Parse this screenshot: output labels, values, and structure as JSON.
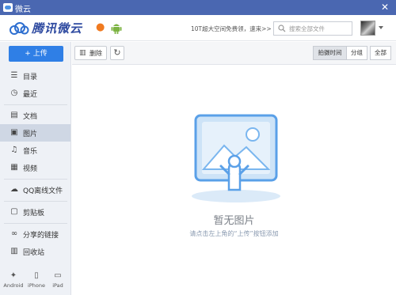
{
  "window": {
    "title": "微云",
    "close_glyph": "✕"
  },
  "header": {
    "logo_text": "腾讯微云",
    "promo": "10T超大空间免费领，速来>>",
    "search_placeholder": "搜索全部文件"
  },
  "sidebar": {
    "upload_label": "+ 上传",
    "items": [
      {
        "label": "目录",
        "icon": "catalog-icon"
      },
      {
        "label": "最近",
        "icon": "clock-icon"
      },
      {
        "label": "文档",
        "icon": "document-icon"
      },
      {
        "label": "图片",
        "icon": "image-icon",
        "active": true
      },
      {
        "label": "音乐",
        "icon": "music-icon"
      },
      {
        "label": "视频",
        "icon": "video-icon"
      },
      {
        "label": "QQ离线文件",
        "icon": "qq-icon"
      },
      {
        "label": "剪贴板",
        "icon": "clipboard-icon"
      },
      {
        "label": "分享的链接",
        "icon": "link-icon"
      },
      {
        "label": "回收站",
        "icon": "trash-icon"
      }
    ],
    "devices": [
      {
        "label": "Android",
        "icon": "android-icon"
      },
      {
        "label": "iPhone",
        "icon": "iphone-icon"
      },
      {
        "label": "iPad",
        "icon": "ipad-icon"
      }
    ]
  },
  "toolbar": {
    "delete_label": "删除",
    "view_modes": [
      {
        "label": "拍摄时间",
        "active": true
      },
      {
        "label": "分组",
        "active": false
      },
      {
        "label": "全部",
        "active": false
      }
    ]
  },
  "empty_state": {
    "title": "暂无图片",
    "hint": "请点击左上角的“上传”按钮添加"
  },
  "colors": {
    "titlebar": "#4a67b1",
    "accent": "#2f7fe6",
    "sidebar_bg": "#eef1f6",
    "active_item": "#cfd7e4"
  }
}
